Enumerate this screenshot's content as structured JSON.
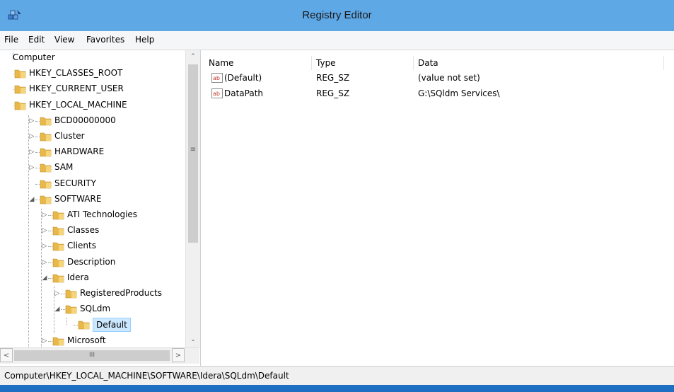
{
  "window": {
    "title": "Registry Editor"
  },
  "menu": [
    "File",
    "Edit",
    "View",
    "Favorites",
    "Help"
  ],
  "tree": {
    "root": "Computer",
    "items": [
      {
        "label": "HKEY_CLASSES_ROOT",
        "expander": "▷"
      },
      {
        "label": "HKEY_CURRENT_USER",
        "expander": "▷"
      },
      {
        "label": "HKEY_LOCAL_MACHINE",
        "expander": "◢"
      },
      {
        "label": "BCD00000000",
        "expander": "▷"
      },
      {
        "label": "Cluster",
        "expander": "▷"
      },
      {
        "label": "HARDWARE",
        "expander": "▷"
      },
      {
        "label": "SAM",
        "expander": "▷"
      },
      {
        "label": "SECURITY",
        "expander": ""
      },
      {
        "label": "SOFTWARE",
        "expander": "◢"
      },
      {
        "label": "ATI Technologies",
        "expander": "▷"
      },
      {
        "label": "Classes",
        "expander": "▷"
      },
      {
        "label": "Clients",
        "expander": "▷"
      },
      {
        "label": "Description",
        "expander": "▷"
      },
      {
        "label": "Idera",
        "expander": "◢"
      },
      {
        "label": "RegisteredProducts",
        "expander": "▷"
      },
      {
        "label": "SQLdm",
        "expander": "◢"
      },
      {
        "label": "Default",
        "expander": ""
      },
      {
        "label": "Microsoft",
        "expander": "▷"
      }
    ]
  },
  "scroll": {
    "up": "⌃",
    "down": "⌄",
    "left": "<",
    "right": ">",
    "grip_v": "≡",
    "grip_h": "III"
  },
  "list": {
    "columns": [
      "Name",
      "Type",
      "Data"
    ],
    "rows": [
      {
        "name": "(Default)",
        "type": "REG_SZ",
        "data": "(value not set)"
      },
      {
        "name": "DataPath",
        "type": "REG_SZ",
        "data": "G:\\SQldm Services\\"
      }
    ]
  },
  "status": {
    "path": "Computer\\HKEY_LOCAL_MACHINE\\SOFTWARE\\Idera\\SQLdm\\Default"
  },
  "colors": {
    "titlebar": "#5fa8e6",
    "frame": "#1e6fc4",
    "folder": "#e8b84a",
    "selection": "#cce8ff"
  }
}
